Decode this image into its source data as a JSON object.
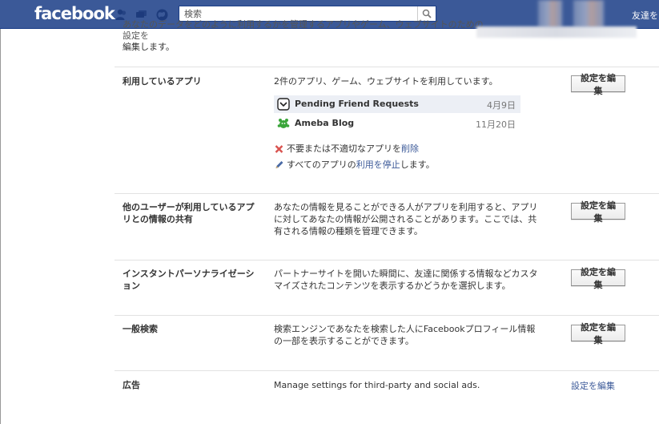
{
  "header": {
    "logo": "facebook",
    "search_placeholder": "検索",
    "friends_link": "友達を"
  },
  "intro": {
    "line1": "あなたのデータをどのように利用するかを管理するアプリやゲーム、ウェブサイトのための設定を",
    "line2": "編集します。"
  },
  "sections": {
    "apps": {
      "label": "利用しているアプリ",
      "desc": "2件のアプリ、ゲーム、ウェブサイトを利用しています。",
      "button": "設定を編集",
      "items": [
        {
          "name": "Pending Friend Requests",
          "date": "4月9日",
          "icon": "pending-requests-icon"
        },
        {
          "name": "Ameba Blog",
          "date": "11月20日",
          "icon": "ameba-icon"
        }
      ],
      "remove_prefix": "不要または不適切なアプリを",
      "remove_link": "削除",
      "stop_prefix": "すべてのアプリの",
      "stop_link": "利用を停止",
      "stop_suffix": "します。"
    },
    "friends": {
      "label_l1": "他のユーザーが利用しているアプ",
      "label_l2": "リとの情報の共有",
      "desc_l1": "あなたの情報を見ることができる人がアプリを利用すると、アプリ",
      "desc_l2": "に対してあなたの情報が公開されることがあります。ここでは、共",
      "desc_l3": "有される情報の種類を管理できます。",
      "button": "設定を編集"
    },
    "instant": {
      "label_l1": "インスタントパーソナライゼーシ",
      "label_l2": "ョン",
      "desc_l1": "パートナーサイトを開いた瞬間に、友達に関係する情報などカスタ",
      "desc_l2": "マイズされたコンテンツを表示するかどうかを選択します。",
      "button": "設定を編集"
    },
    "search": {
      "label": "一般検索",
      "desc_l1": "検索エンジンであなたを検索した人にFacebookプロフィール情報",
      "desc_l2": "の一部を表示することができます。",
      "button": "設定を編集"
    },
    "ads": {
      "label": "広告",
      "desc": "Manage settings for third-party and social ads.",
      "link": "設定を編集"
    }
  },
  "colors": {
    "brand": "#3b5998",
    "link": "#3b5998",
    "row_shade": "#eceff5"
  }
}
